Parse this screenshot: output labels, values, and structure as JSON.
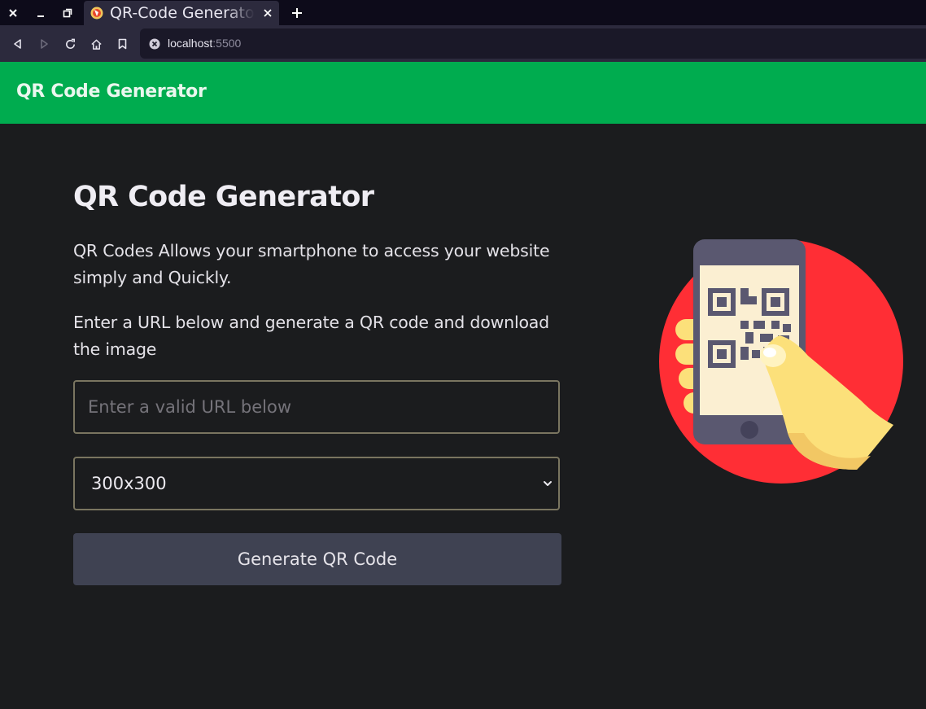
{
  "browser": {
    "tab_title": "QR-Code Generator",
    "url_host": "localhost",
    "url_port": ":5500"
  },
  "app": {
    "brand": "QR Code Generator"
  },
  "main": {
    "heading": "QR Code Generator",
    "paragraph1": "QR Codes Allows your smartphone to access your website simply and Quickly.",
    "paragraph2": "Enter a URL below and generate a QR code and download the image",
    "url_input": {
      "placeholder": "Enter a valid URL below",
      "value": ""
    },
    "size_select": {
      "selected": "300x300"
    },
    "generate_button": "Generate QR Code"
  },
  "colors": {
    "header_green": "#00ac4f",
    "background": "#1b1c1e",
    "button": "#3f4252",
    "hero_circle": "#ff2e35"
  },
  "icons": {
    "window": [
      "close-icon",
      "minimize-icon",
      "restore-icon"
    ],
    "nav": [
      "back-icon",
      "forward-icon",
      "reload-icon",
      "home-icon",
      "bookmark-icon"
    ],
    "hero": "phone-qr-illustration"
  }
}
